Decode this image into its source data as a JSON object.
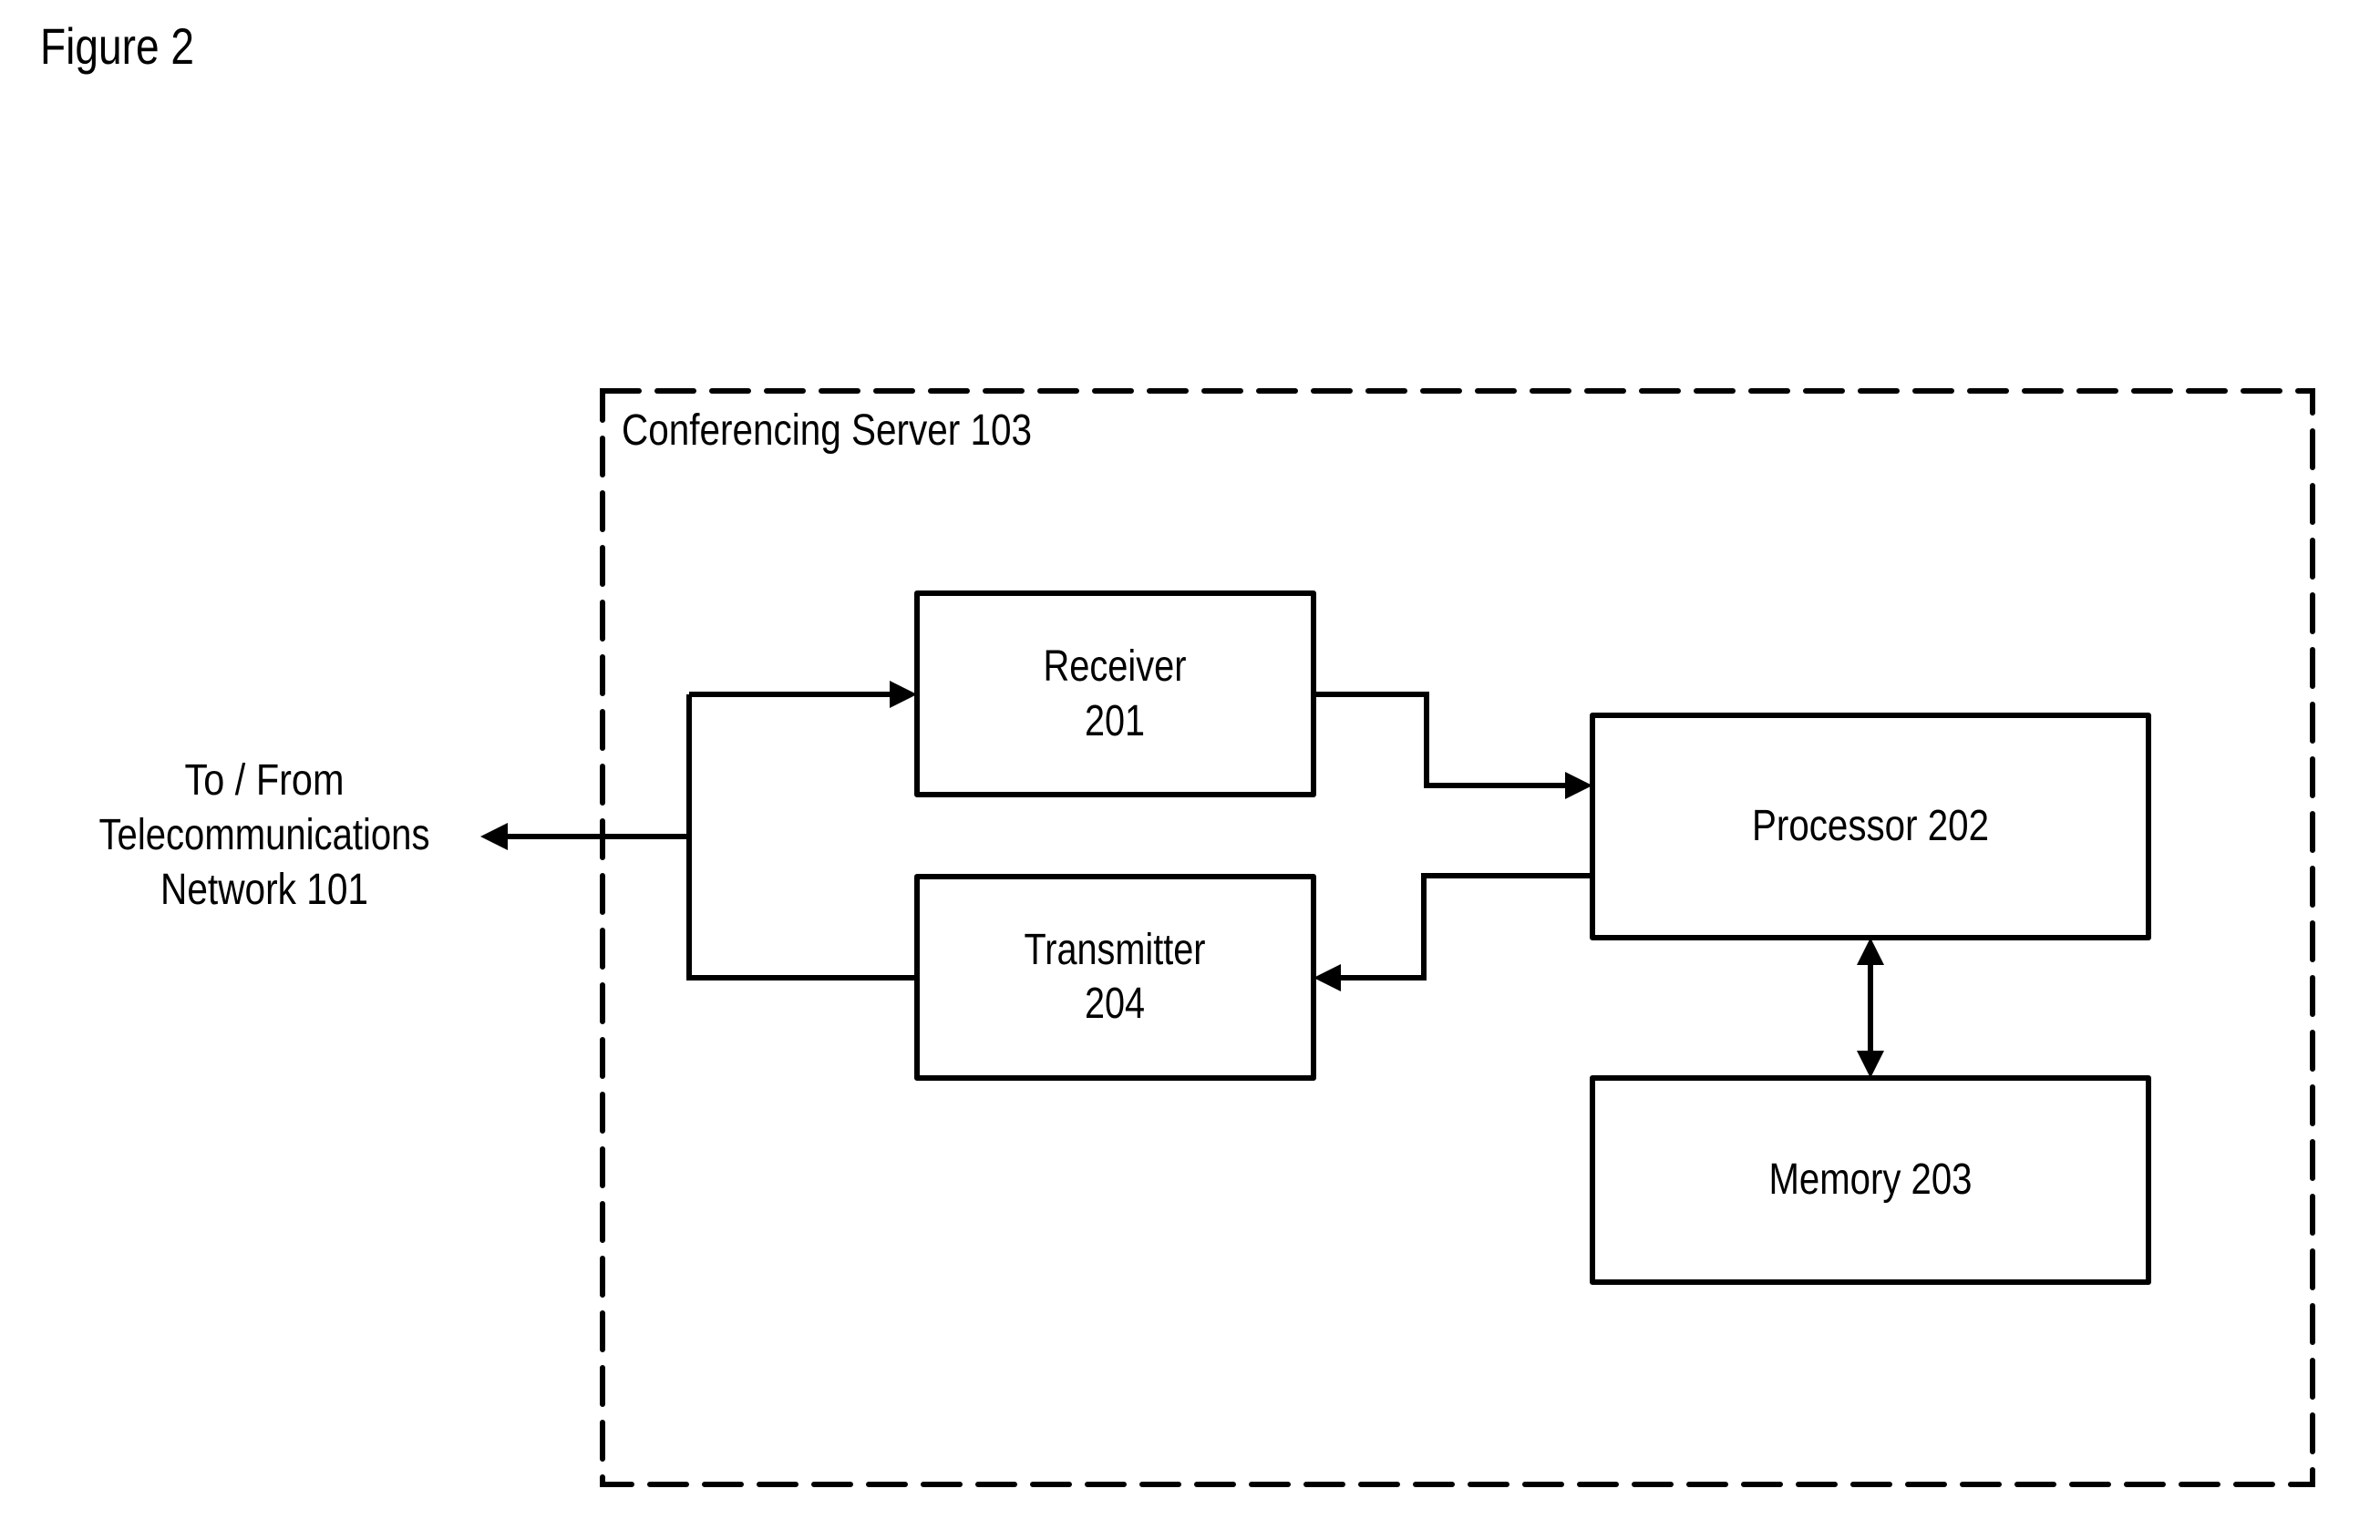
{
  "figure": {
    "title": "Figure 2"
  },
  "diagram": {
    "container": {
      "label": "Conferencing Server 103",
      "style": "dashed"
    },
    "external": {
      "lines": [
        "To / From",
        "Telecommunications",
        "Network 101"
      ]
    },
    "blocks": {
      "receiver": {
        "lines": [
          "Receiver",
          "201"
        ]
      },
      "transmitter": {
        "lines": [
          "Transmitter",
          "204"
        ]
      },
      "processor": {
        "label": "Processor 202"
      },
      "memory": {
        "label": "Memory 203"
      }
    },
    "connections": [
      {
        "from": "bus",
        "to": "receiver",
        "direction": "one-way"
      },
      {
        "from": "receiver",
        "to": "processor",
        "direction": "one-way"
      },
      {
        "from": "processor",
        "to": "transmitter",
        "direction": "one-way"
      },
      {
        "from": "transmitter",
        "to": "bus",
        "direction": "none"
      },
      {
        "from": "bus",
        "to": "external",
        "direction": "one-way"
      },
      {
        "from": "processor",
        "to": "memory",
        "direction": "two-way"
      }
    ],
    "colors": {
      "stroke": "#000000",
      "background": "#ffffff"
    }
  }
}
